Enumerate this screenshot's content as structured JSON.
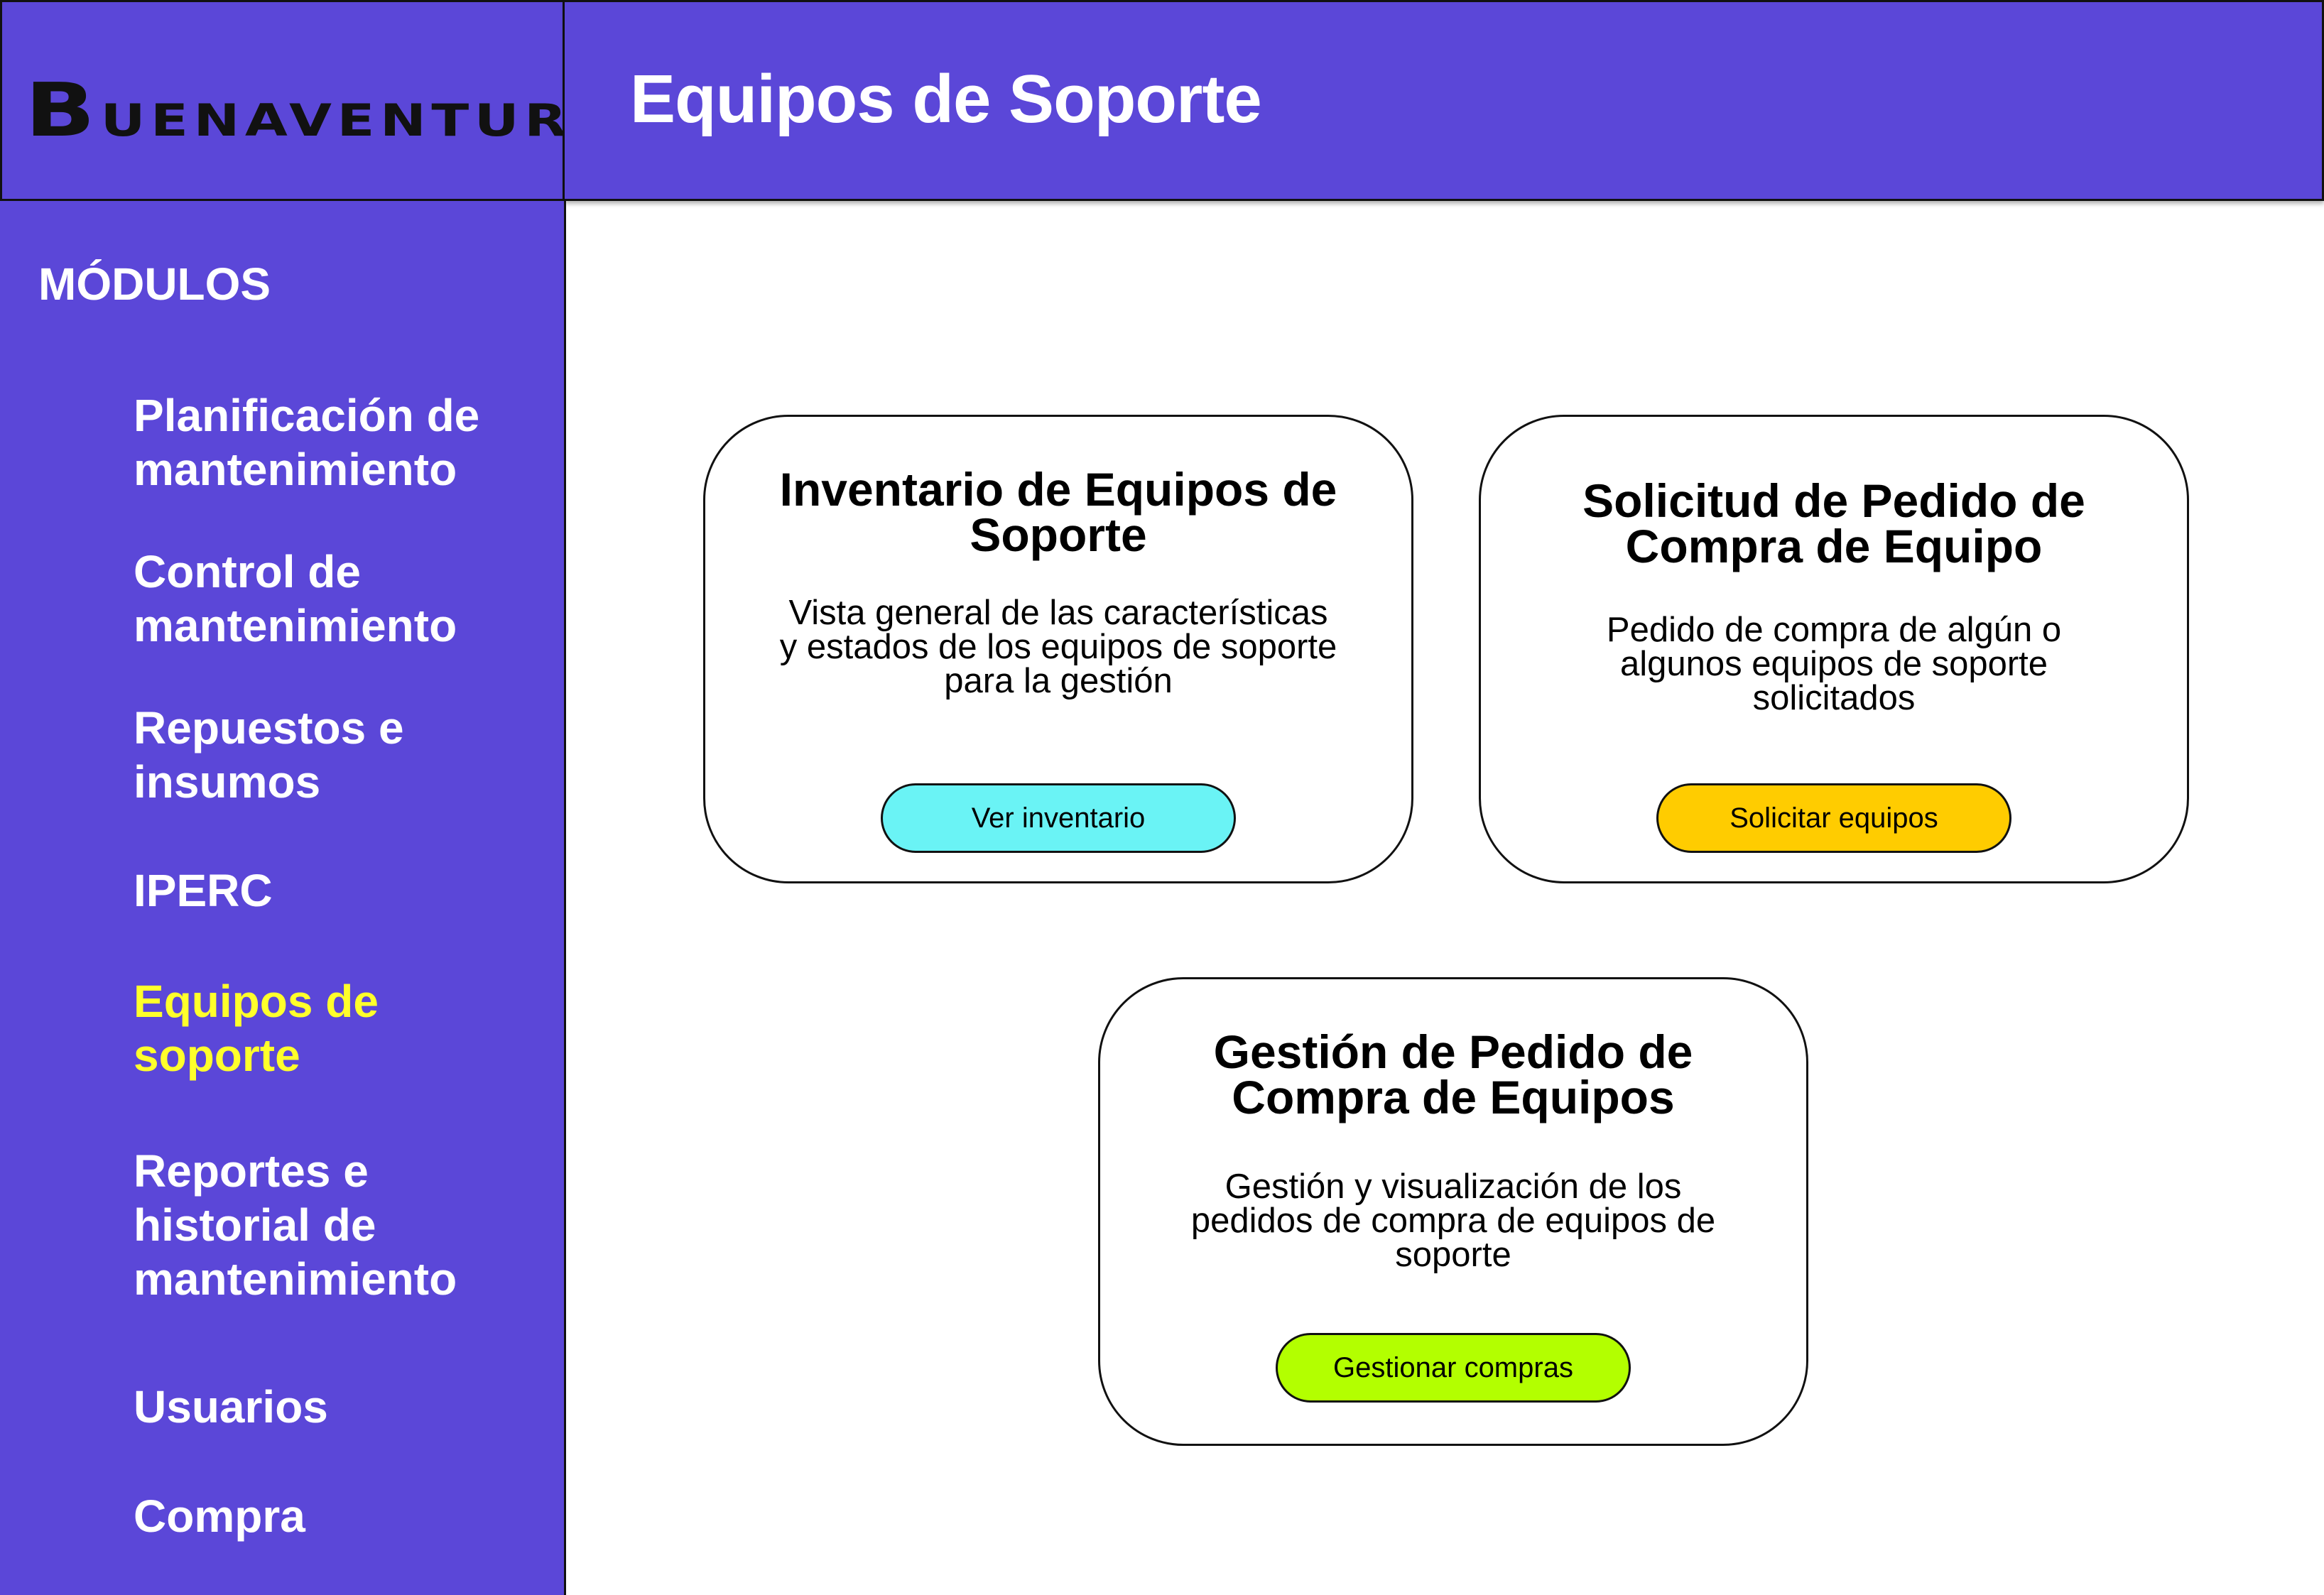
{
  "app": {
    "logo_initial": "B",
    "logo_rest": "UENAVENTURA"
  },
  "header": {
    "title": "Equipos de Soporte"
  },
  "sidebar": {
    "heading": "MÓDULOS",
    "items": [
      {
        "label": "Planificación de mantenimiento",
        "active": false
      },
      {
        "label": "Control de mantenimiento",
        "active": false
      },
      {
        "label": "Repuestos e insumos",
        "active": false
      },
      {
        "label": "IPERC",
        "active": false
      },
      {
        "label": "Equipos de soporte",
        "active": true
      },
      {
        "label": "Reportes e historial de mantenimiento",
        "active": false
      },
      {
        "label": "Usuarios",
        "active": false
      },
      {
        "label": "Compra",
        "active": false
      }
    ]
  },
  "cards": [
    {
      "title": "Inventario de Equipos de Soporte",
      "description": "Vista general de las características y estados de los equipos de soporte para la gestión",
      "button": "Ver inventario",
      "button_color": "#6af3f5"
    },
    {
      "title": "Solicitud de Pedido de Compra de Equipo",
      "description": "Pedido de compra de algún o algunos equipos de soporte solicitados",
      "button": "Solicitar equipos",
      "button_color": "#ffcc00"
    },
    {
      "title": "Gestión de Pedido de Compra de Equipos",
      "description": "Gestión y visualización de los pedidos de compra de equipos de soporte",
      "button": "Gestionar compras",
      "button_color": "#b3ff00"
    }
  ],
  "colors": {
    "primary": "#5b47d8",
    "active_nav": "#ffff2b",
    "border": "#111111",
    "background": "#ffffff"
  }
}
